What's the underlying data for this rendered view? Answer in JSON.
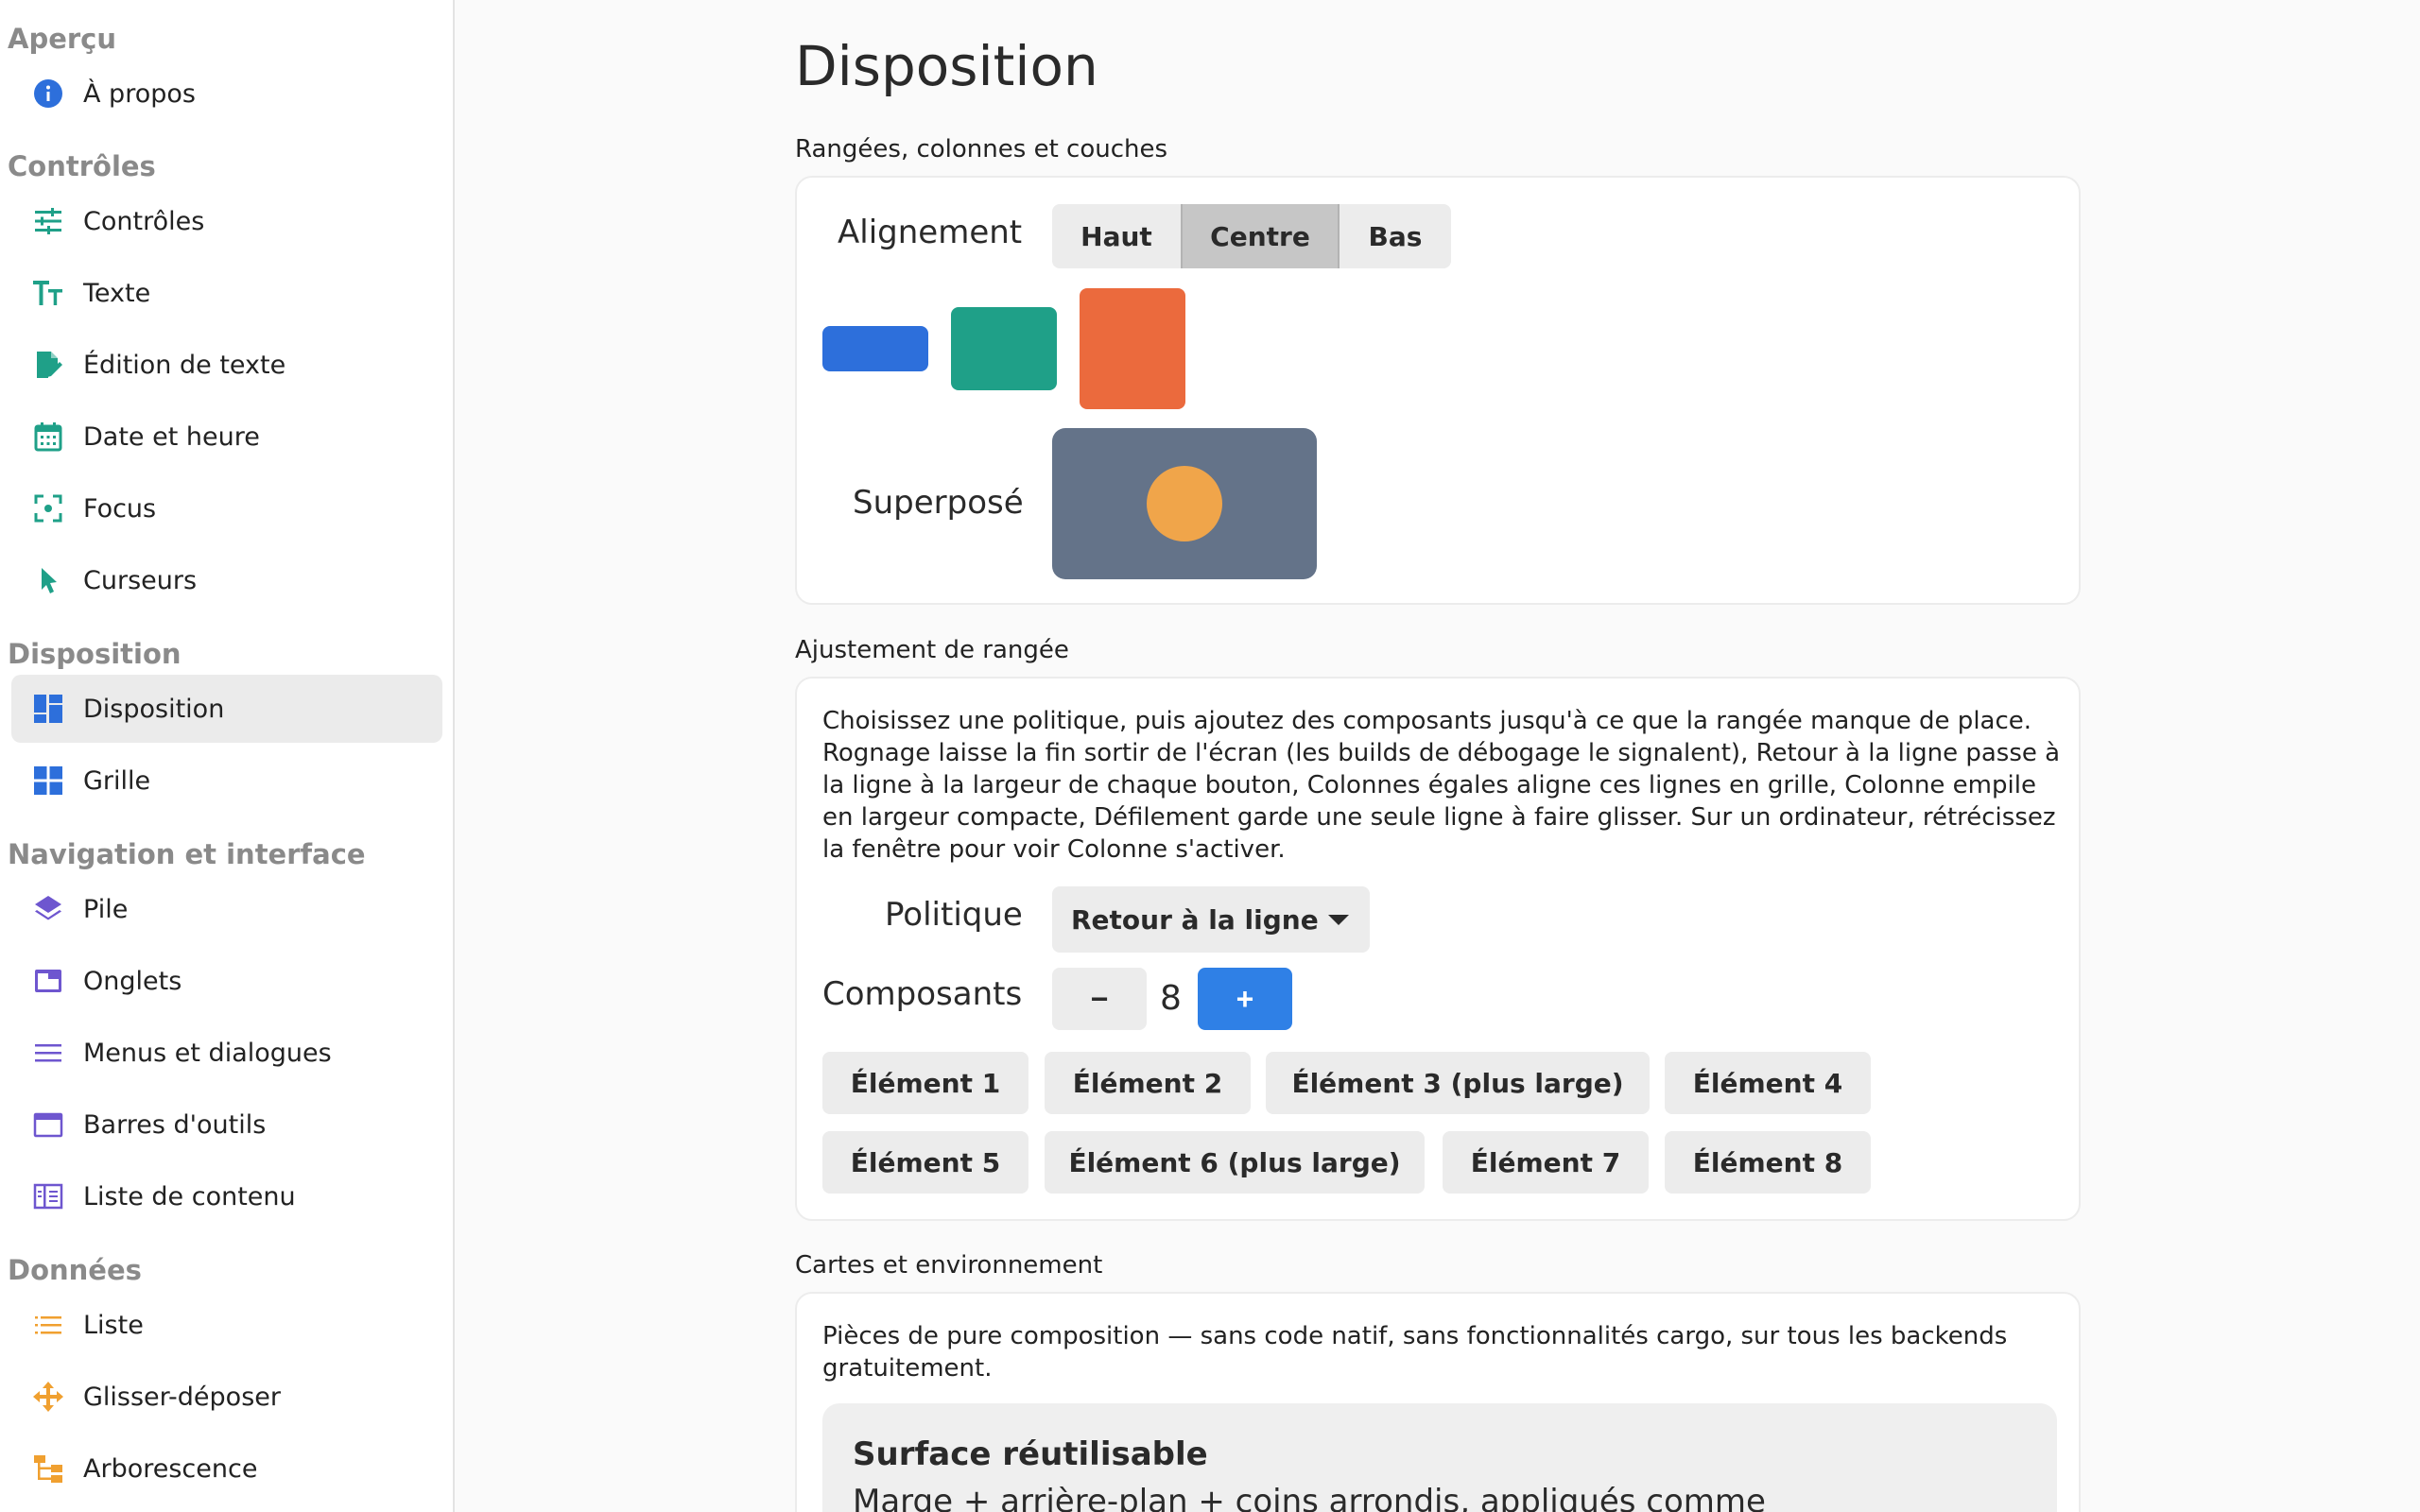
{
  "sidebar": {
    "sections": [
      {
        "title": "Aperçu",
        "items": [
          {
            "label": "À propos",
            "icon": "info-icon"
          }
        ]
      },
      {
        "title": "Contrôles",
        "items": [
          {
            "label": "Contrôles",
            "icon": "sliders-icon"
          },
          {
            "label": "Texte",
            "icon": "text-size-icon"
          },
          {
            "label": "Édition de texte",
            "icon": "edit-document-icon"
          },
          {
            "label": "Date et heure",
            "icon": "calendar-icon"
          },
          {
            "label": "Focus",
            "icon": "focus-icon"
          },
          {
            "label": "Curseurs",
            "icon": "cursor-icon"
          }
        ]
      },
      {
        "title": "Disposition",
        "items": [
          {
            "label": "Disposition",
            "icon": "layout-icon",
            "active": true
          },
          {
            "label": "Grille",
            "icon": "grid-icon"
          }
        ]
      },
      {
        "title": "Navigation et interface",
        "items": [
          {
            "label": "Pile",
            "icon": "layers-icon"
          },
          {
            "label": "Onglets",
            "icon": "tabs-icon"
          },
          {
            "label": "Menus et dialogues",
            "icon": "menu-icon"
          },
          {
            "label": "Barres d'outils",
            "icon": "toolbar-icon"
          },
          {
            "label": "Liste de contenu",
            "icon": "content-list-icon"
          }
        ]
      },
      {
        "title": "Données",
        "items": [
          {
            "label": "Liste",
            "icon": "list-icon"
          },
          {
            "label": "Glisser-déposer",
            "icon": "move-icon"
          },
          {
            "label": "Arborescence",
            "icon": "tree-icon"
          }
        ]
      }
    ]
  },
  "main": {
    "title": "Disposition",
    "rows_group": {
      "title": "Rangées, colonnes et couches",
      "alignment_label": "Alignement",
      "alignment_options": [
        "Haut",
        "Centre",
        "Bas"
      ],
      "alignment_selected": "Centre",
      "overlay_label": "Superposé",
      "colors": {
        "blue": "#2d6fdb",
        "teal": "#1fa088",
        "orange": "#eb6a3d",
        "slate": "#647389",
        "gold": "#f0a54a"
      }
    },
    "wrap_group": {
      "title": "Ajustement de rangée",
      "description": "Choisissez une politique, puis ajoutez des composants jusqu'à ce que la rangée manque de place. Rognage laisse la fin sortir de l'écran (les builds de débogage le signalent), Retour à la ligne passe à la ligne à la largeur de chaque bouton, Colonnes égales aligne ces lignes en grille, Colonne empile en largeur compacte, Défilement garde une seule ligne à faire glisser. Sur un ordinateur, rétrécissez la fenêtre pour voir Colonne s'activer.",
      "policy_label": "Politique",
      "policy_value": "Retour à la ligne",
      "components_label": "Composants",
      "minus": "−",
      "plus": "+",
      "count": "8",
      "elements": [
        "Élément 1",
        "Élément 2",
        "Élément 3 (plus large)",
        "Élément 4",
        "Élément 5",
        "Élément 6 (plus large)",
        "Élément 7",
        "Élément 8"
      ],
      "accent": "#2f80e6"
    },
    "cards_group": {
      "title": "Cartes et environnement",
      "description": "Pièces de pure composition — sans code natif, sans fonctionnalités cargo, sur tous les backends gratuitement.",
      "surface_title": "Surface réutilisable",
      "surface_text": "Marge + arrière-plan + coins arrondis, appliqués comme"
    }
  }
}
